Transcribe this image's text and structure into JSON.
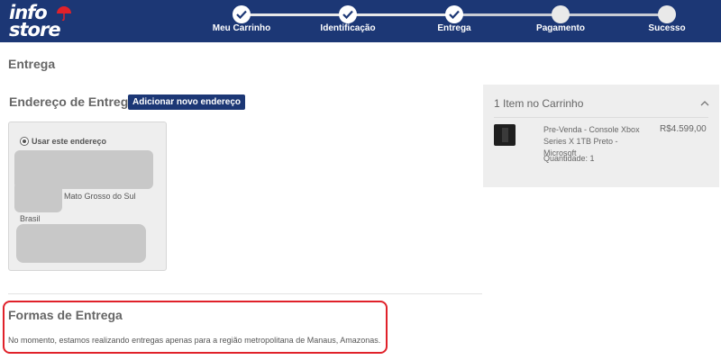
{
  "logo": {
    "line1": "info",
    "line2": "store"
  },
  "steps": [
    {
      "label": "Meu Carrinho",
      "done": true
    },
    {
      "label": "Identificação",
      "done": true
    },
    {
      "label": "Entrega",
      "done": true
    },
    {
      "label": "Pagamento",
      "done": false
    },
    {
      "label": "Sucesso",
      "done": false
    }
  ],
  "page_title": "Entrega",
  "address": {
    "heading": "Endereço de Entrega",
    "add_button": "Adicionar novo endereço",
    "use_label": "Usar este endereço",
    "state": "Mato Grosso do Sul",
    "country": "Brasil"
  },
  "shipping": {
    "heading": "Formas de Entrega",
    "message": "No momento, estamos realizando entregas apenas para a região metropolitana de Manaus, Amazonas."
  },
  "cart": {
    "title": "1 Item no Carrinho",
    "product_name": "Pre-Venda - Console Xbox Series X 1TB Preto - Microsoft",
    "price": "R$4.599,00",
    "quantity": "Quantidade: 1"
  },
  "colors": {
    "header": "#1c3775",
    "accent_red": "#e0212a",
    "panel": "#eeeeee"
  }
}
